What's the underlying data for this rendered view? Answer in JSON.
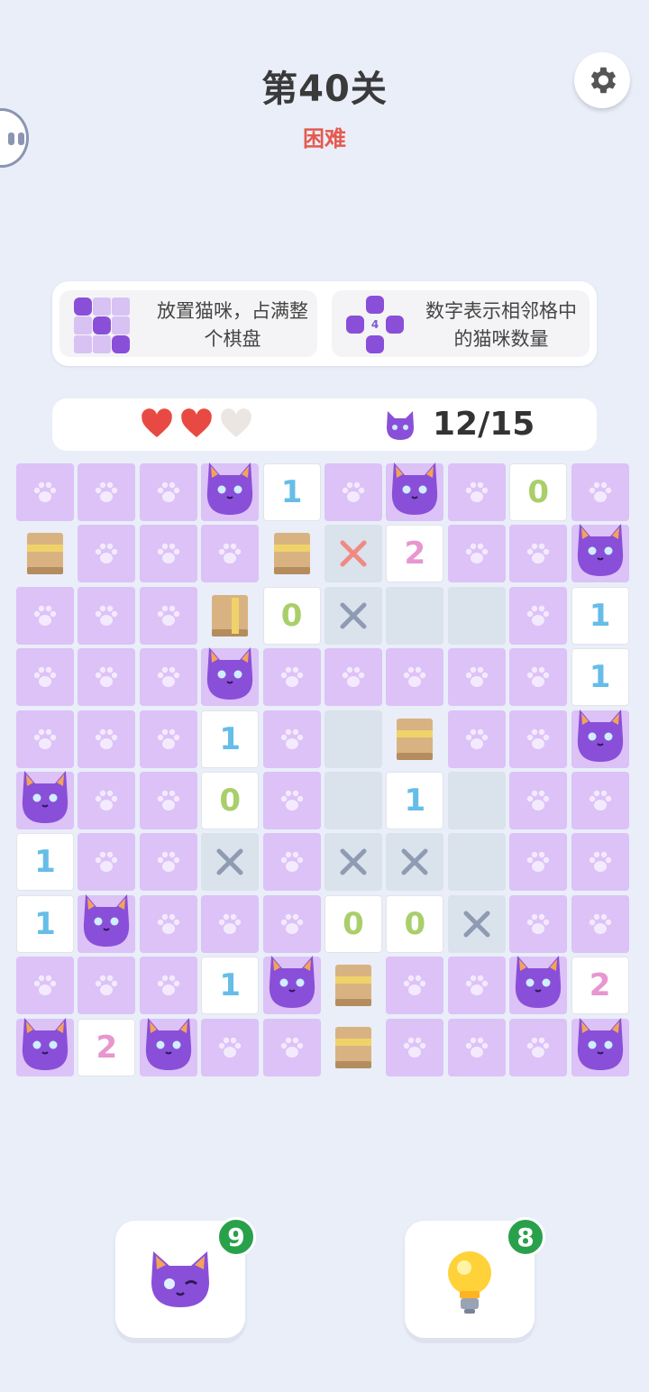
{
  "header": {
    "level_title": "第40关",
    "difficulty": "困难",
    "settings_icon": "gear-icon",
    "side_tab_icon": "robot-face-icon"
  },
  "tips": {
    "tip1": "放置猫咪，占满整个棋盘",
    "tip2": "数字表示相邻格中的猫咪数量",
    "tip2_example_number": "4"
  },
  "status": {
    "hearts": [
      "full",
      "full",
      "empty"
    ],
    "cat_count": "12/15"
  },
  "colors": {
    "paw_cell": "#dcc2f7",
    "cat": "#8a4fd8",
    "difficulty": "#e45a4f",
    "badge": "#29a14a",
    "heart": "#e84a43"
  },
  "board": {
    "rows": [
      [
        "paw",
        "paw",
        "paw",
        "cat",
        "1",
        "paw",
        "cat",
        "paw",
        "0",
        "paw"
      ],
      [
        "box",
        "paw",
        "paw",
        "paw",
        "box",
        "xr",
        "2",
        "paw",
        "paw",
        "cat"
      ],
      [
        "paw",
        "paw",
        "paw",
        "box",
        "0",
        "x",
        "e",
        "e",
        "paw",
        "1"
      ],
      [
        "paw",
        "paw",
        "paw",
        "cat",
        "paw",
        "paw",
        "paw",
        "paw",
        "paw",
        "1"
      ],
      [
        "paw",
        "paw",
        "paw",
        "1",
        "paw",
        "e",
        "box",
        "paw",
        "paw",
        "cat"
      ],
      [
        "cat",
        "paw",
        "paw",
        "0",
        "paw",
        "e",
        "1",
        "e",
        "paw",
        "paw"
      ],
      [
        "1",
        "paw",
        "paw",
        "x",
        "paw",
        "x",
        "x",
        "e",
        "paw",
        "paw"
      ],
      [
        "1",
        "cat",
        "paw",
        "paw",
        "paw",
        "0",
        "0",
        "x",
        "paw",
        "paw"
      ],
      [
        "paw",
        "paw",
        "paw",
        "1",
        "cat",
        "box",
        "paw",
        "paw",
        "cat",
        "2"
      ],
      [
        "cat",
        "2",
        "cat",
        "paw",
        "paw",
        "box",
        "paw",
        "paw",
        "paw",
        "cat"
      ]
    ]
  },
  "buttons": {
    "place_cat": {
      "icon": "cat-winking-icon",
      "count": "9"
    },
    "hint": {
      "icon": "lightbulb-icon",
      "count": "8"
    }
  }
}
